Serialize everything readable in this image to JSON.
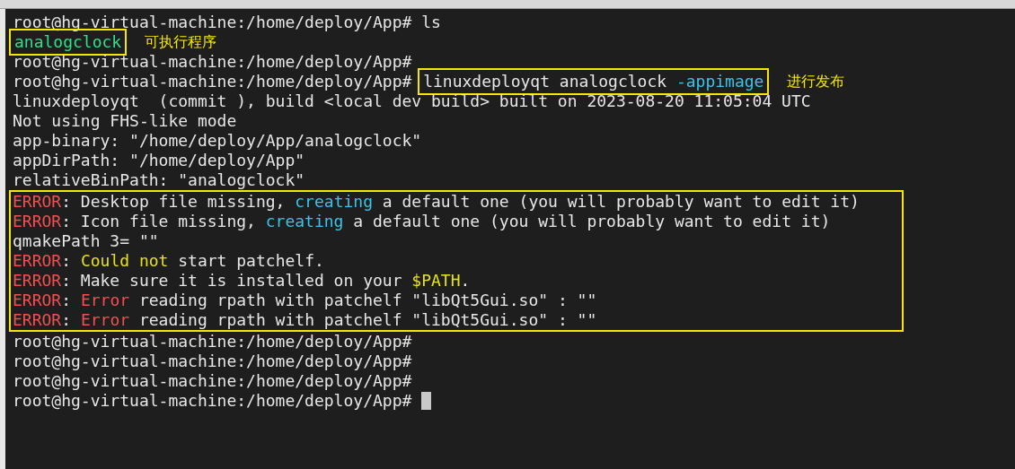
{
  "terminal": {
    "blocks": [
      {
        "kind": "line",
        "segments": [
          {
            "text": "root@hg-virtual-machine:/home/deploy/App# ls",
            "kind": "plain"
          }
        ]
      },
      {
        "kind": "line",
        "boxed": [
          {
            "text": "analogclock",
            "kind": "exec"
          }
        ],
        "note": "可执行程序"
      },
      {
        "kind": "line",
        "segments": [
          {
            "text": "root@hg-virtual-machine:/home/deploy/App#",
            "kind": "plain"
          }
        ]
      },
      {
        "kind": "line",
        "segments": [
          {
            "text": "root@hg-virtual-machine:/home/deploy/App# ",
            "kind": "plain"
          }
        ],
        "boxed": [
          {
            "text": "linuxdeployqt analogclock ",
            "kind": "plain"
          },
          {
            "text": "-appimage",
            "kind": "info"
          }
        ],
        "note": "进行发布"
      },
      {
        "kind": "line",
        "segments": [
          {
            "text": "linuxdeployqt  (commit ), build <local dev build> built on 2023-08-20 11:05:04 UTC",
            "kind": "plain"
          }
        ]
      },
      {
        "kind": "line",
        "segments": [
          {
            "text": "Not using FHS-like mode",
            "kind": "plain"
          }
        ]
      },
      {
        "kind": "line",
        "segments": [
          {
            "text": "app-binary: \"/home/deploy/App/analogclock\"",
            "kind": "plain"
          }
        ]
      },
      {
        "kind": "line",
        "segments": [
          {
            "text": "appDirPath: \"/home/deploy/App\"",
            "kind": "plain"
          }
        ]
      },
      {
        "kind": "line",
        "segments": [
          {
            "text": "relativeBinPath: \"analogclock\"",
            "kind": "plain"
          }
        ]
      },
      {
        "kind": "group",
        "lines": [
          {
            "segments": [
              {
                "text": "ERROR",
                "kind": "error"
              },
              {
                "text": ": Desktop file missing, ",
                "kind": "plain"
              },
              {
                "text": "creating",
                "kind": "info"
              },
              {
                "text": " a default one (you will probably want to edit it)",
                "kind": "plain"
              }
            ]
          },
          {
            "segments": [
              {
                "text": "ERROR",
                "kind": "error"
              },
              {
                "text": ": Icon file missing, ",
                "kind": "plain"
              },
              {
                "text": "creating",
                "kind": "info"
              },
              {
                "text": " a default one (you will probably want to edit it)",
                "kind": "plain"
              }
            ]
          },
          {
            "segments": [
              {
                "text": "qmakePath 3= \"\"",
                "kind": "plain"
              }
            ]
          },
          {
            "segments": [
              {
                "text": "ERROR",
                "kind": "error"
              },
              {
                "text": ": ",
                "kind": "plain"
              },
              {
                "text": "Could not",
                "kind": "warn"
              },
              {
                "text": " start patchelf.",
                "kind": "plain"
              }
            ]
          },
          {
            "segments": [
              {
                "text": "ERROR",
                "kind": "error"
              },
              {
                "text": ": Make sure it is installed on your ",
                "kind": "plain"
              },
              {
                "text": "$PATH",
                "kind": "warn"
              },
              {
                "text": ".",
                "kind": "plain"
              }
            ]
          },
          {
            "segments": [
              {
                "text": "ERROR",
                "kind": "error"
              },
              {
                "text": ": ",
                "kind": "plain"
              },
              {
                "text": "Error",
                "kind": "error"
              },
              {
                "text": " reading rpath with patchelf \"libQt5Gui.so\" : \"\"",
                "kind": "plain"
              }
            ]
          },
          {
            "segments": [
              {
                "text": "ERROR",
                "kind": "error"
              },
              {
                "text": ": ",
                "kind": "plain"
              },
              {
                "text": "Error",
                "kind": "error"
              },
              {
                "text": " reading rpath with patchelf \"libQt5Gui.so\" : \"\"",
                "kind": "plain"
              }
            ]
          }
        ]
      },
      {
        "kind": "line",
        "segments": [
          {
            "text": "root@hg-virtual-machine:/home/deploy/App#",
            "kind": "plain"
          }
        ]
      },
      {
        "kind": "line",
        "segments": [
          {
            "text": "root@hg-virtual-machine:/home/deploy/App#",
            "kind": "plain"
          }
        ]
      },
      {
        "kind": "line",
        "segments": [
          {
            "text": "root@hg-virtual-machine:/home/deploy/App#",
            "kind": "plain"
          }
        ]
      },
      {
        "kind": "line",
        "segments": [
          {
            "text": "root@hg-virtual-machine:/home/deploy/App# ",
            "kind": "plain"
          }
        ],
        "cursor": true
      }
    ]
  }
}
